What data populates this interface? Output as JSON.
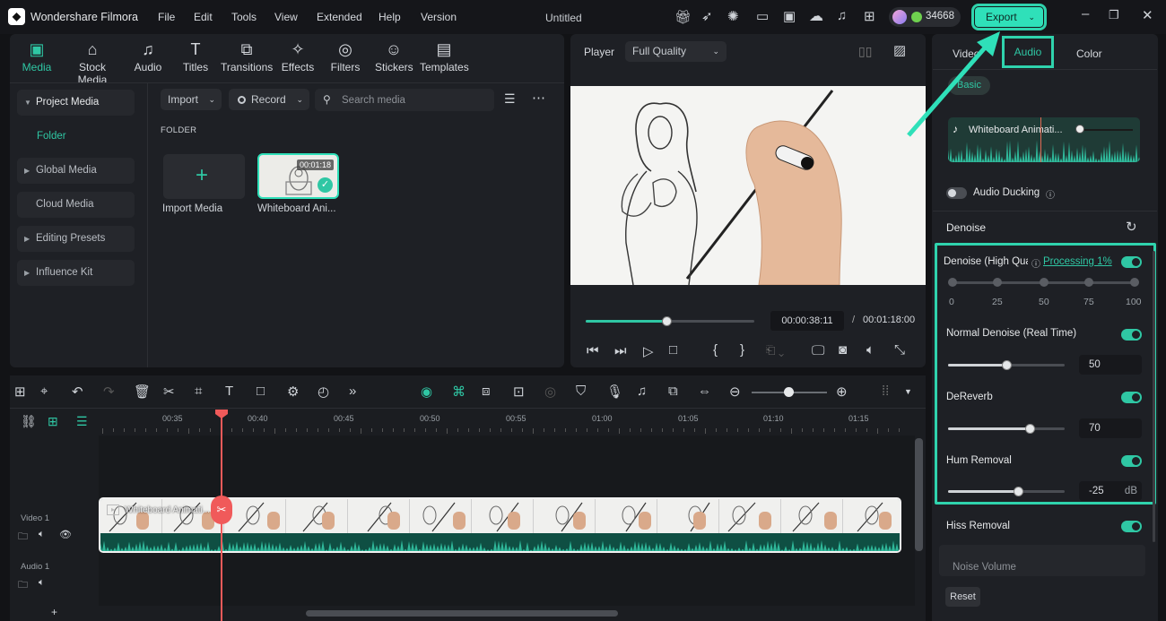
{
  "app": {
    "name": "Wondershare Filmora",
    "project": "Untitled",
    "credits": "34668",
    "export_label": "Export"
  },
  "menu": [
    "File",
    "Edit",
    "Tools",
    "View",
    "Extended",
    "Help",
    "Version"
  ],
  "media_tabs": [
    {
      "label": "Media",
      "icon": "media-icon",
      "active": true
    },
    {
      "label": "Stock Media",
      "icon": "stock-media-icon"
    },
    {
      "label": "Audio",
      "icon": "music-note-icon"
    },
    {
      "label": "Titles",
      "icon": "titles-icon"
    },
    {
      "label": "Transitions",
      "icon": "transitions-icon"
    },
    {
      "label": "Effects",
      "icon": "effects-icon"
    },
    {
      "label": "Filters",
      "icon": "filters-icon"
    },
    {
      "label": "Stickers",
      "icon": "stickers-icon"
    },
    {
      "label": "Templates",
      "icon": "templates-icon"
    }
  ],
  "sidebar": {
    "items": [
      "Project Media",
      "Folder",
      "Global Media",
      "Cloud Media",
      "Editing Presets",
      "Influence Kit"
    ]
  },
  "media_toolbar": {
    "import_label": "Import",
    "record_label": "Record",
    "search_placeholder": "Search media"
  },
  "folder_label": "FOLDER",
  "media_items": [
    {
      "label": "Import Media"
    },
    {
      "label": "Whiteboard Ani...",
      "duration": "00:01:18"
    }
  ],
  "player": {
    "label": "Player",
    "quality": "Full Quality",
    "current_time": "00:00:38:11",
    "separator": "/",
    "total_time": "00:01:18:00",
    "progress": 0.48
  },
  "right_tabs": [
    "Video",
    "Audio",
    "Color"
  ],
  "audio": {
    "preset": "Basic",
    "clip_name": "Whiteboard Animati...",
    "audio_ducking": "Audio Ducking",
    "denoise_title": "Denoise",
    "ai_denoise_label": "Denoise (High Qua",
    "processing": "Processing 1%",
    "scale": [
      "0",
      "25",
      "50",
      "75",
      "100"
    ],
    "normal_denoise": {
      "label": "Normal Denoise (Real Time)",
      "value": "50",
      "level": 0.5
    },
    "dereverb": {
      "label": "DeReverb",
      "value": "70",
      "level": 0.7
    },
    "hum_removal": {
      "label": "Hum Removal",
      "value": "-25",
      "unit": "dB",
      "level": 0.6
    },
    "hiss_removal": "Hiss Removal",
    "noise_volume": "Noise Volume",
    "reset": "Reset"
  },
  "timeline": {
    "ruler": [
      "00:35",
      "00:40",
      "00:45",
      "00:50",
      "00:55",
      "01:00",
      "01:05",
      "01:10",
      "01:15"
    ],
    "clip_name": "Whiteboard Animati...",
    "tracks": [
      {
        "label": "Video 1"
      },
      {
        "label": "Audio 1"
      }
    ]
  },
  "colors": {
    "accent": "#2fc7a4",
    "playhead": "#f05a5a",
    "annotation": "#2fe0b9"
  }
}
